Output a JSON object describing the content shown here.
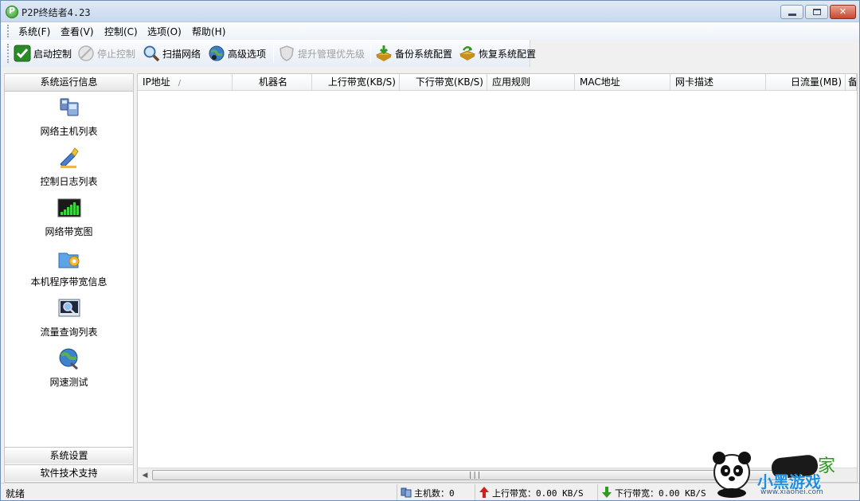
{
  "window": {
    "title": "P2P终结者4.23"
  },
  "menu": [
    {
      "label": "系统(F)"
    },
    {
      "label": "查看(V)"
    },
    {
      "label": "控制(C)"
    },
    {
      "label": "选项(O)"
    },
    {
      "label": "帮助(H)"
    }
  ],
  "toolbar": {
    "start": "启动控制",
    "stop": "停止控制",
    "scan": "扫描网络",
    "advanced": "高级选项",
    "priority": "提升管理优先级",
    "backup": "备份系统配置",
    "restore": "恢复系统配置"
  },
  "sidebar": {
    "header": "系统运行信息",
    "items": [
      {
        "label": "网络主机列表",
        "icon": "network-hosts-icon"
      },
      {
        "label": "控制日志列表",
        "icon": "control-log-icon"
      },
      {
        "label": "网络带宽图",
        "icon": "bandwidth-chart-icon"
      },
      {
        "label": "本机程序带宽信息",
        "icon": "program-bandwidth-icon"
      },
      {
        "label": "流量查询列表",
        "icon": "traffic-query-icon"
      },
      {
        "label": "网速测试",
        "icon": "speed-test-icon"
      }
    ],
    "footer": [
      "系统设置",
      "软件技术支持"
    ]
  },
  "table": {
    "columns": [
      {
        "label": "IP地址",
        "sort": "/"
      },
      {
        "label": "机器名"
      },
      {
        "label": "上行带宽(KB/S)"
      },
      {
        "label": "下行带宽(KB/S)"
      },
      {
        "label": "应用规则"
      },
      {
        "label": "MAC地址"
      },
      {
        "label": "网卡描述"
      },
      {
        "label": "日流量(MB)"
      },
      {
        "label": "备"
      }
    ],
    "rows": []
  },
  "statusbar": {
    "state": "就绪",
    "hosts_label": "主机数：0",
    "up_label": "上行带宽：0.00 KB/S",
    "down_label": "下行带宽：0.00 KB/S"
  },
  "watermark": {
    "brand": "小黑游戏",
    "tag": "家",
    "url": "www.xiaohei.com"
  },
  "colors": {
    "accent_green": "#2f9a2a",
    "up_arrow": "#d0201a",
    "down_arrow": "#2e9a1e"
  }
}
